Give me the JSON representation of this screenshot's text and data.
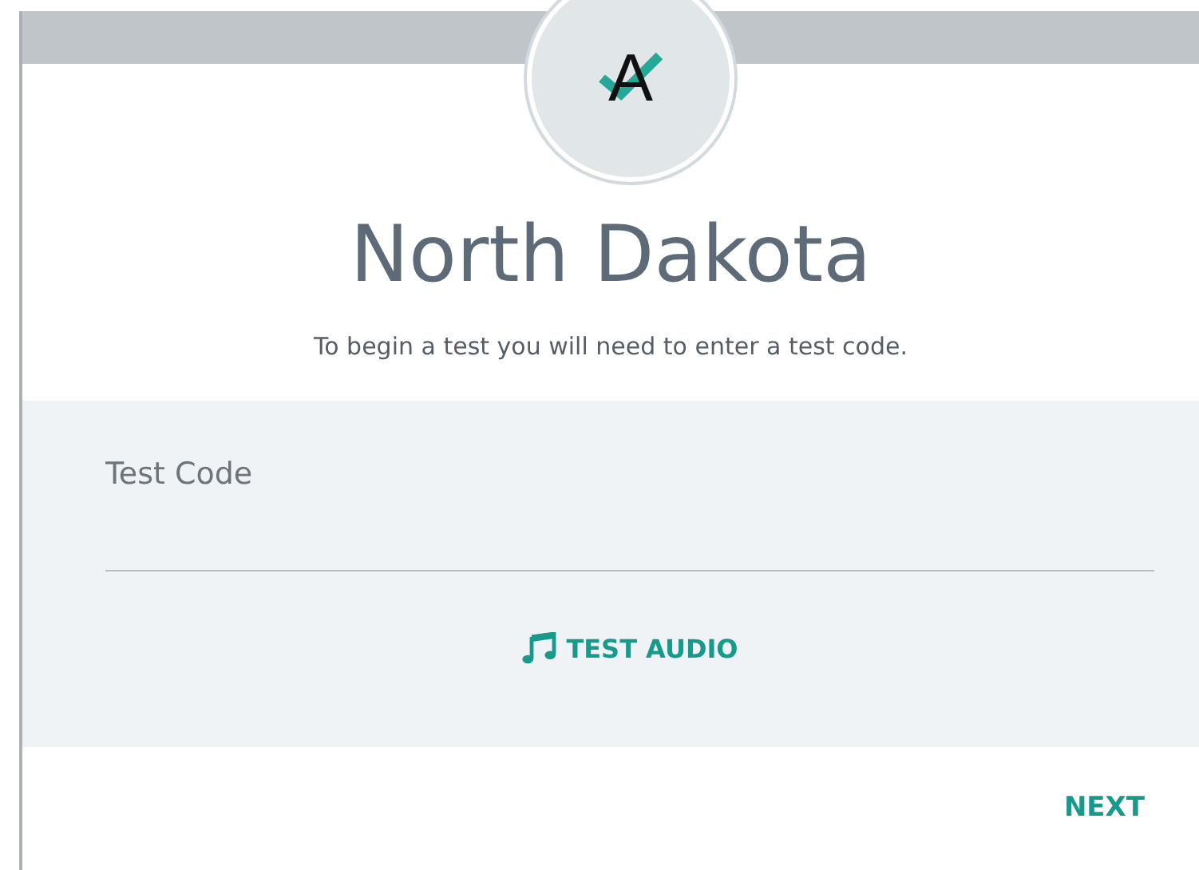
{
  "logo": {
    "letter": "A"
  },
  "title": "North Dakota",
  "subtitle": "To begin a test you will need to enter a test code.",
  "test_code_field": {
    "placeholder": "Test Code"
  },
  "test_audio_button": {
    "label": "TEST AUDIO"
  },
  "next_button": {
    "label": "NEXT"
  }
}
